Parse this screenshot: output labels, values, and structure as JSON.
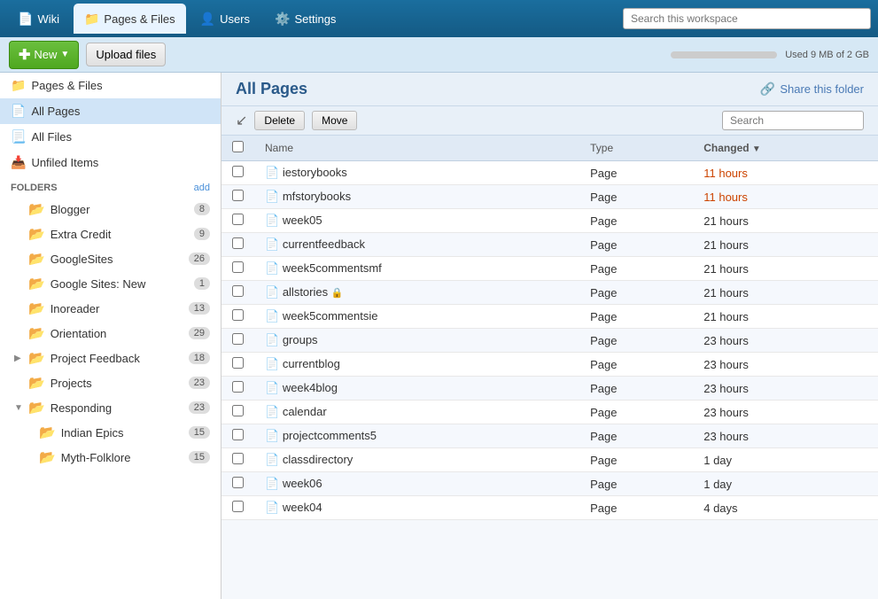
{
  "topNav": {
    "tabs": [
      {
        "id": "wiki",
        "label": "Wiki",
        "icon": "📄",
        "active": false
      },
      {
        "id": "pages-files",
        "label": "Pages & Files",
        "icon": "📁",
        "active": true
      },
      {
        "id": "users",
        "label": "Users",
        "icon": "👤",
        "active": false
      },
      {
        "id": "settings",
        "label": "Settings",
        "icon": "⚙️",
        "active": false
      }
    ],
    "searchPlaceholder": "Search this workspace"
  },
  "toolbar": {
    "newLabel": "New",
    "uploadLabel": "Upload files",
    "storageText": "Used 9 MB of 2 GB"
  },
  "sidebar": {
    "items": [
      {
        "id": "pages-files",
        "label": "Pages & Files",
        "icon": "📁"
      },
      {
        "id": "all-pages",
        "label": "All Pages",
        "icon": "📄",
        "active": true
      },
      {
        "id": "all-files",
        "label": "All Files",
        "icon": "📃"
      },
      {
        "id": "unfiled-items",
        "label": "Unfiled Items",
        "icon": "📥"
      }
    ],
    "foldersHeader": "FOLDERS",
    "addLabel": "add",
    "folders": [
      {
        "id": "blogger",
        "label": "Blogger",
        "count": 8,
        "expanded": false,
        "indent": 0
      },
      {
        "id": "extra-credit",
        "label": "Extra Credit",
        "count": 9,
        "expanded": false,
        "indent": 0
      },
      {
        "id": "google-sites",
        "label": "GoogleSites",
        "count": 26,
        "expanded": false,
        "indent": 0
      },
      {
        "id": "google-sites-new",
        "label": "Google Sites: New",
        "count": 1,
        "expanded": false,
        "indent": 0
      },
      {
        "id": "inoreader",
        "label": "Inoreader",
        "count": 13,
        "expanded": false,
        "indent": 0
      },
      {
        "id": "orientation",
        "label": "Orientation",
        "count": 29,
        "expanded": false,
        "indent": 0
      },
      {
        "id": "project-feedback",
        "label": "Project Feedback",
        "count": 18,
        "expanded": false,
        "indent": 0,
        "hasToggle": true
      },
      {
        "id": "projects",
        "label": "Projects",
        "count": 23,
        "expanded": false,
        "indent": 0
      },
      {
        "id": "responding",
        "label": "Responding",
        "count": 23,
        "expanded": true,
        "indent": 0
      },
      {
        "id": "indian-epics",
        "label": "Indian Epics",
        "count": 15,
        "expanded": false,
        "indent": 1
      },
      {
        "id": "myth-folklore",
        "label": "Myth-Folklore",
        "count": 15,
        "expanded": false,
        "indent": 1
      }
    ]
  },
  "content": {
    "title": "All Pages",
    "shareLabel": "Share this folder",
    "deleteLabel": "Delete",
    "moveLabel": "Move",
    "searchPlaceholder": "Search",
    "columns": [
      "Name",
      "Type",
      "Changed"
    ],
    "files": [
      {
        "name": "iestorybooks",
        "type": "Page",
        "changed": "11 hours",
        "highlight": true
      },
      {
        "name": "mfstorybooks",
        "type": "Page",
        "changed": "11 hours",
        "highlight": true
      },
      {
        "name": "week05",
        "type": "Page",
        "changed": "21 hours",
        "highlight": false
      },
      {
        "name": "currentfeedback",
        "type": "Page",
        "changed": "21 hours",
        "highlight": false
      },
      {
        "name": "week5commentsmf",
        "type": "Page",
        "changed": "21 hours",
        "highlight": false
      },
      {
        "name": "allstories",
        "type": "Page",
        "changed": "21 hours",
        "highlight": false,
        "hasLock": true
      },
      {
        "name": "week5commentsie",
        "type": "Page",
        "changed": "21 hours",
        "highlight": false
      },
      {
        "name": "groups",
        "type": "Page",
        "changed": "23 hours",
        "highlight": false
      },
      {
        "name": "currentblog",
        "type": "Page",
        "changed": "23 hours",
        "highlight": false
      },
      {
        "name": "week4blog",
        "type": "Page",
        "changed": "23 hours",
        "highlight": false
      },
      {
        "name": "calendar",
        "type": "Page",
        "changed": "23 hours",
        "highlight": false
      },
      {
        "name": "projectcomments5",
        "type": "Page",
        "changed": "23 hours",
        "highlight": false
      },
      {
        "name": "classdirectory",
        "type": "Page",
        "changed": "1 day",
        "highlight": false
      },
      {
        "name": "week06",
        "type": "Page",
        "changed": "1 day",
        "highlight": false
      },
      {
        "name": "week04",
        "type": "Page",
        "changed": "4 days",
        "highlight": false
      }
    ]
  }
}
